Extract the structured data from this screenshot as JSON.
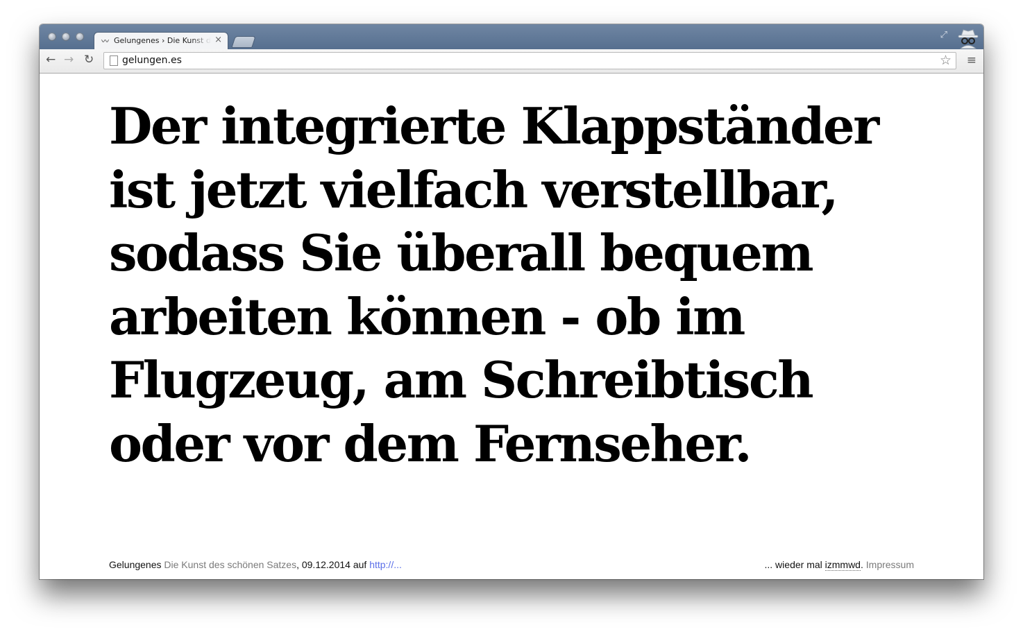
{
  "browser": {
    "tab_title": "Gelungenes › Die Kunst des schönen Satzes",
    "tab_icon": "mustache-icon",
    "close_glyph": "×",
    "url": "gelungen.es"
  },
  "page": {
    "headline": "Der integrierte Klappständer ist jetzt vielfach verstellbar, sodass Sie überall bequem arbeiten können - ob im Flugzeug, am Schreibtisch oder vor dem Fernseher.",
    "footer": {
      "site_name": "Gelungenes",
      "tagline": "Die Kunst des schönen Satzes",
      "date_prefix": ",",
      "date": "09.12.2014",
      "source_prefix": "auf",
      "source_link": "http://...",
      "wieder_text": "... wieder mal",
      "izmmwd": "izmmwd",
      "period": ".",
      "impressum": "Impressum"
    }
  },
  "colors": {
    "tabstrip": "#5f7797",
    "link": "#5a6ee8",
    "muted": "#7a7a7a"
  }
}
